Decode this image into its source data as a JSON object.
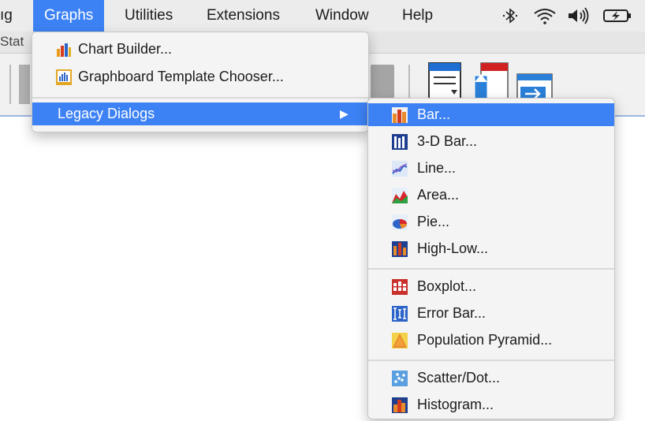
{
  "menubar": {
    "items": [
      {
        "label": "ıg",
        "active": false
      },
      {
        "label": "Graphs",
        "active": true
      },
      {
        "label": "Utilities",
        "active": false
      },
      {
        "label": "Extensions",
        "active": false
      },
      {
        "label": "Window",
        "active": false
      },
      {
        "label": "Help",
        "active": false
      }
    ],
    "status_icons": [
      "bluetooth-icon",
      "wifi-icon",
      "volume-icon",
      "battery-charging-icon"
    ]
  },
  "window": {
    "tab_fragment": "Stat"
  },
  "graphs_menu": {
    "items": [
      {
        "label": "Chart Builder...",
        "icon": "chart-builder-icon"
      },
      {
        "label": "Graphboard Template Chooser...",
        "icon": "graphboard-icon"
      },
      {
        "label": "Legacy Dialogs",
        "submenu_arrow": "▶",
        "highlighted": true
      }
    ]
  },
  "legacy_menu": {
    "groups": [
      [
        {
          "label": "Bar...",
          "icon": "bar-chart-icon",
          "highlighted": true
        },
        {
          "label": "3-D Bar...",
          "icon": "3d-bar-chart-icon"
        },
        {
          "label": "Line...",
          "icon": "line-chart-icon"
        },
        {
          "label": "Area...",
          "icon": "area-chart-icon"
        },
        {
          "label": "Pie...",
          "icon": "pie-chart-icon"
        },
        {
          "label": "High-Low...",
          "icon": "high-low-chart-icon"
        }
      ],
      [
        {
          "label": "Boxplot...",
          "icon": "boxplot-icon"
        },
        {
          "label": "Error Bar...",
          "icon": "error-bar-icon"
        },
        {
          "label": "Population Pyramid...",
          "icon": "population-pyramid-icon"
        }
      ],
      [
        {
          "label": "Scatter/Dot...",
          "icon": "scatter-dot-icon"
        },
        {
          "label": "Histogram...",
          "icon": "histogram-icon"
        }
      ]
    ]
  },
  "colors": {
    "highlight": "#3d82f4",
    "menubar_bg": "#ececec",
    "menu_bg": "#f4f4f4"
  }
}
